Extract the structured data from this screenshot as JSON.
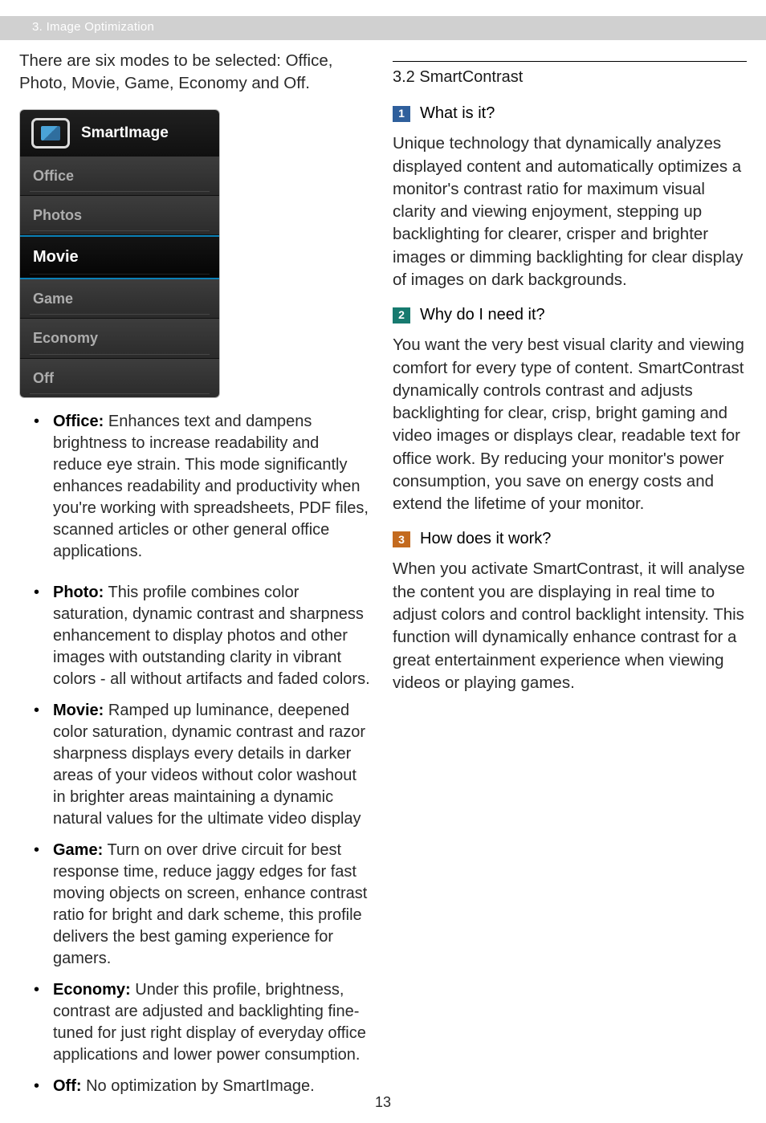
{
  "chapter_bar": "3. Image Optimization",
  "left": {
    "intro": "There are six modes to be selected: Office, Photo, Movie, Game, Economy and Off.",
    "menu": {
      "title": "SmartImage",
      "items": [
        "Office",
        "Photos",
        "Movie",
        "Game",
        "Economy",
        "Off"
      ],
      "selected_index": 2
    },
    "bullets": [
      {
        "term": "Office:",
        "text": " Enhances text and dampens brightness to increase readability and reduce eye strain. This mode significantly enhances readability and productivity when you're working with spreadsheets, PDF files, scanned articles or other general office applications."
      },
      {
        "term": "Photo:",
        "text": " This profile combines color saturation, dynamic contrast and sharpness enhancement to display photos and other images with outstanding clarity in vibrant colors - all without artifacts and faded colors."
      },
      {
        "term": "Movie:",
        "text": " Ramped up luminance, deepened color saturation, dynamic contrast and razor sharpness displays every details in darker areas of your videos without color washout in brighter areas maintaining a dynamic natural values for the ultimate video display"
      },
      {
        "term": "Game:",
        "text": " Turn on over drive circuit for best response time, reduce jaggy edges for fast moving objects on screen, enhance contrast ratio for bright and dark scheme, this profile delivers the best gaming experience for gamers."
      },
      {
        "term": "Economy:",
        "text": " Under this profile, brightness, contrast are adjusted and backlighting fine-tuned for just right display of everyday office applications and lower power consumption."
      },
      {
        "term": "Off:",
        "text": " No optimization by SmartImage."
      }
    ]
  },
  "right": {
    "section_title": "3.2 SmartContrast",
    "q1": {
      "num": "1",
      "label": "What is it?"
    },
    "p1": "Unique technology that dynamically analyzes displayed content and automatically optimizes a monitor's contrast ratio for maximum visual clarity and viewing enjoyment, stepping up backlighting for clearer, crisper and brighter images or dimming backlighting for clear display of images on dark backgrounds.",
    "q2": {
      "num": "2",
      "label": "Why do I need it?"
    },
    "p2": "You want the very best visual clarity and viewing comfort for every type of content. SmartContrast dynamically controls contrast and adjusts backlighting for clear, crisp, bright gaming and video images or displays clear, readable text for office work. By reducing your monitor's power consumption, you save on energy costs and extend the lifetime of your monitor.",
    "q3": {
      "num": "3",
      "label": "How does it work?"
    },
    "p3": "When you activate SmartContrast, it will analyse the content you are displaying in real time to adjust colors and control backlight intensity. This function will dynamically enhance contrast for a great entertainment experience when viewing videos or playing games."
  },
  "page_number": "13"
}
